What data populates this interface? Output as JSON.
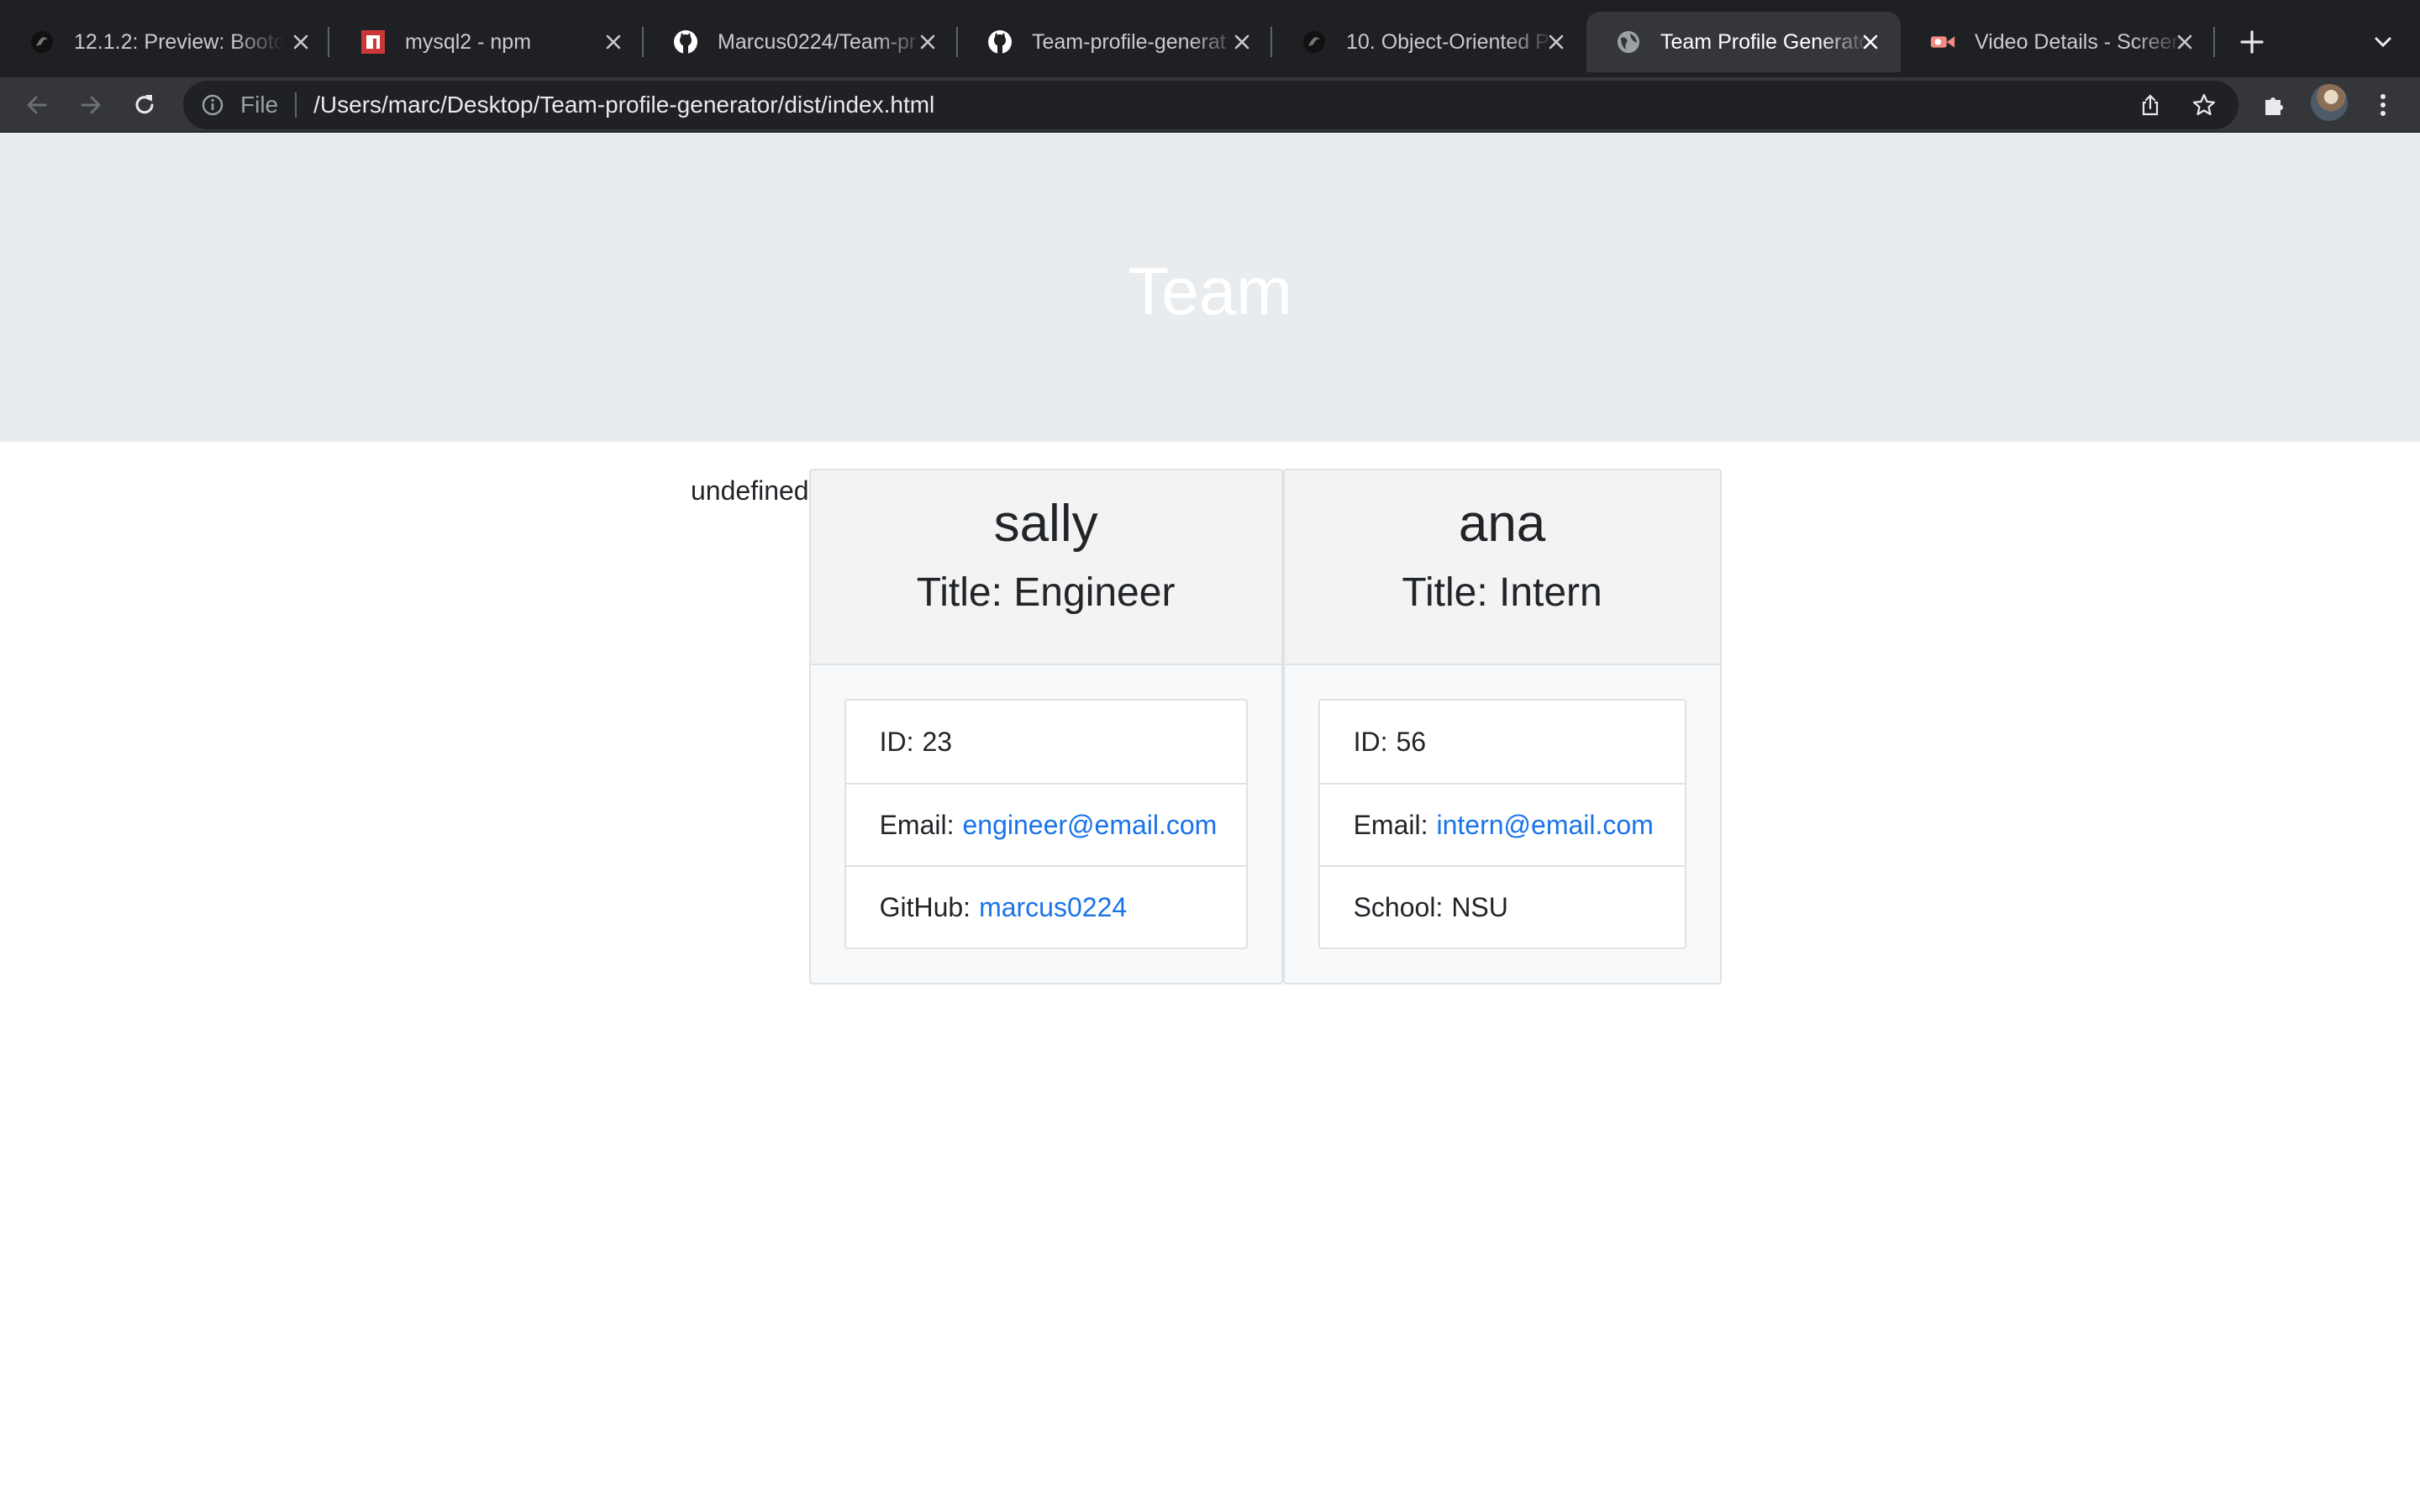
{
  "browser": {
    "tabs": [
      {
        "title": "12.1.2: Preview: Bootc",
        "icon": "bcs-logo-icon",
        "active": false
      },
      {
        "title": "mysql2 - npm",
        "icon": "npm-icon",
        "active": false
      },
      {
        "title": "Marcus0224/Team-pr",
        "icon": "github-icon",
        "active": false
      },
      {
        "title": "Team-profile-generat",
        "icon": "github-icon",
        "active": false
      },
      {
        "title": "10. Object-Oriented P",
        "icon": "bcs-logo-icon",
        "active": false
      },
      {
        "title": "Team Profile Generato",
        "icon": "globe-icon",
        "active": true
      },
      {
        "title": "Video Details - Screen",
        "icon": "screencastify-icon",
        "active": false
      }
    ],
    "address": {
      "scheme_label": "File",
      "url": "/Users/marc/Desktop/Team-profile-generator/dist/index.html"
    }
  },
  "page": {
    "heading": "Team",
    "stray_text": "undefined",
    "cards": [
      {
        "name": "sally",
        "role": "Title: Engineer",
        "id_label": "ID:",
        "id": "23",
        "email_label": "Email:",
        "email": "engineer@email.com",
        "extra_label": "GitHub:",
        "extra_value": "marcus0224",
        "extra_is_link": true
      },
      {
        "name": "ana",
        "role": "Title: Intern",
        "id_label": "ID:",
        "id": "56",
        "email_label": "Email:",
        "email": "intern@email.com",
        "extra_label": "School:",
        "extra_value": "NSU",
        "extra_is_link": false
      }
    ]
  },
  "colors": {
    "tabstrip": "#1f2023",
    "toolbar": "#35363a",
    "jumbotron": "#e9ecef",
    "link": "#1a73e8"
  }
}
